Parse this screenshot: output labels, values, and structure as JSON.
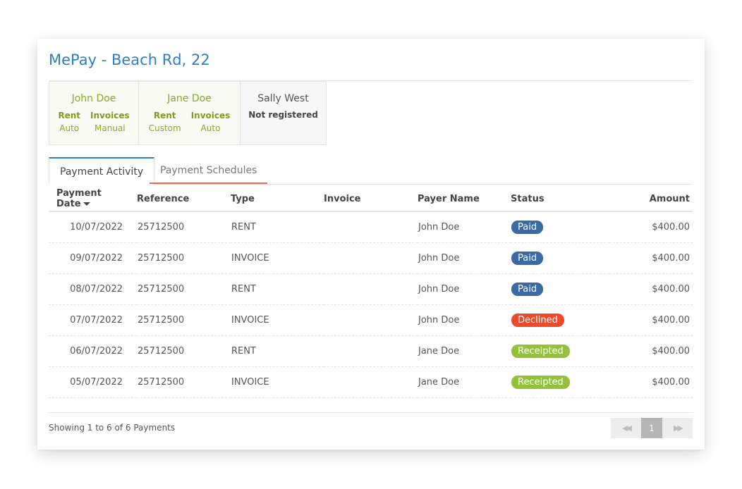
{
  "title": "MePay - Beach Rd, 22",
  "payers": [
    {
      "name": "John Doe",
      "rent_label": "Rent",
      "rent_value": "Auto",
      "invoices_label": "Invoices",
      "invoices_value": "Manual"
    },
    {
      "name": "Jane Doe",
      "rent_label": "Rent",
      "rent_value": "Custom",
      "invoices_label": "Invoices",
      "invoices_value": "Auto"
    },
    {
      "name": "Sally West",
      "status": "Not registered"
    }
  ],
  "tabs": [
    {
      "label": "Payment Activity"
    },
    {
      "label": "Payment Schedules"
    }
  ],
  "table": {
    "headers": {
      "date": "Payment Date",
      "reference": "Reference",
      "type": "Type",
      "invoice": "Invoice",
      "payer": "Payer Name",
      "status": "Status",
      "amount": "Amount"
    },
    "rows": [
      {
        "date": "10/07/2022",
        "reference": "25712500",
        "type": "RENT",
        "invoice": "",
        "payer": "John Doe",
        "status": "Paid",
        "amount": "$400.00"
      },
      {
        "date": "09/07/2022",
        "reference": "25712500",
        "type": "INVOICE",
        "invoice": "",
        "payer": "John Doe",
        "status": "Paid",
        "amount": "$400.00"
      },
      {
        "date": "08/07/2022",
        "reference": "25712500",
        "type": "RENT",
        "invoice": "",
        "payer": "John Doe",
        "status": "Paid",
        "amount": "$400.00"
      },
      {
        "date": "07/07/2022",
        "reference": "25712500",
        "type": "INVOICE",
        "invoice": "",
        "payer": "John Doe",
        "status": "Declined",
        "amount": "$400.00"
      },
      {
        "date": "06/07/2022",
        "reference": "25712500",
        "type": "RENT",
        "invoice": "",
        "payer": "Jane Doe",
        "status": "Receipted",
        "amount": "$400.00"
      },
      {
        "date": "05/07/2022",
        "reference": "25712500",
        "type": "INVOICE",
        "invoice": "",
        "payer": "Jane Doe",
        "status": "Receipted",
        "amount": "$400.00"
      }
    ]
  },
  "status_colors": {
    "Paid": "#3a6aa3",
    "Declined": "#ee4a2a",
    "Receipted": "#94c13a"
  },
  "footer": {
    "showing": "Showing 1 to 6 of 6 Payments",
    "page": "1"
  },
  "icons": {
    "sort": "caret-down-icon",
    "first": "double-chevron-left-icon",
    "last": "double-chevron-right-icon"
  }
}
